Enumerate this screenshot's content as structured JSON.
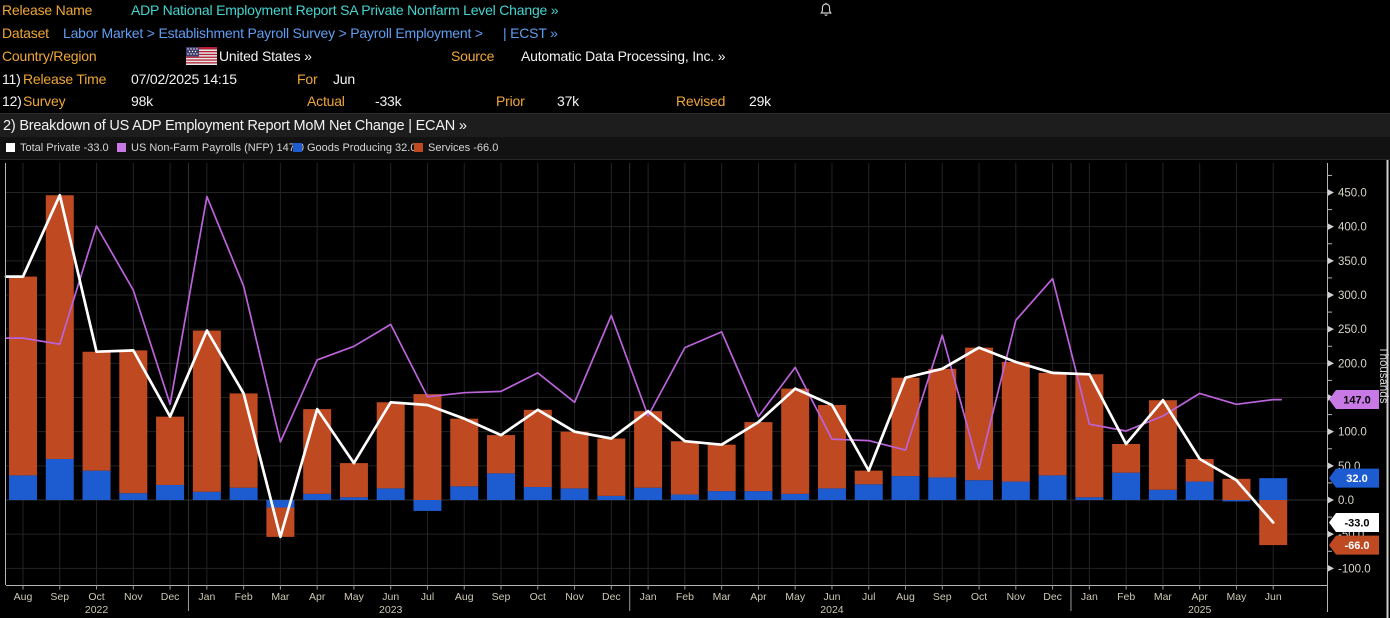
{
  "header": {
    "release_name_label": "Release Name",
    "release_name_value": "ADP National Employment Report SA Private Nonfarm Level Change »",
    "dataset_label": "Dataset",
    "dataset_value": "Labor Market > Establishment Payroll Survey > Payroll Employment >",
    "dataset_suffix": "| ECST »",
    "country_label": "Country/Region",
    "country_value": "United States »",
    "source_label": "Source",
    "source_value": "Automatic Data Processing, Inc. »",
    "row11_num": "11)",
    "release_time_label": "Release Time",
    "release_time_value": "07/02/2025 14:15",
    "for_label": "For",
    "for_value": "Jun",
    "row12_num": "12)",
    "survey_label": "Survey",
    "survey_value": "98k",
    "actual_label": "Actual",
    "actual_value": "-33k",
    "prior_label": "Prior",
    "prior_value": "37k",
    "revised_label": "Revised",
    "revised_value": "29k",
    "bell_icon": "alert-bell"
  },
  "section_title": "2) Breakdown of US ADP Employment Report MoM Net Change | ECAN »",
  "legend": [
    {
      "label": "Total Private -33.0",
      "color": "#ffffff"
    },
    {
      "label": "US Non-Farm Payrolls (NFP) 147.0",
      "color": "#c979e6"
    },
    {
      "label": "Goods Producing 32.0",
      "color": "#1d5bd1"
    },
    {
      "label": "Services -66.0",
      "color": "#bf4a22"
    }
  ],
  "chart_data": {
    "type": "bar",
    "subtype": "stacked bars with overlaid lines",
    "unit_label": "Thousands",
    "ylim": [
      -124,
      494
    ],
    "yticks_major": [
      -100,
      -50,
      0,
      50,
      100,
      150,
      200,
      250,
      300,
      350,
      400,
      450
    ],
    "ytick_minor_step": 25,
    "grid": true,
    "categories": [
      "Aug",
      "Sep",
      "Oct",
      "Nov",
      "Dec",
      "Jan",
      "Feb",
      "Mar",
      "Apr",
      "May",
      "Jun",
      "Jul",
      "Aug",
      "Sep",
      "Oct",
      "Nov",
      "Dec",
      "Jan",
      "Feb",
      "Mar",
      "Apr",
      "May",
      "Jun",
      "Jul",
      "Aug",
      "Sep",
      "Oct",
      "Nov",
      "Dec",
      "Jan",
      "Feb",
      "Mar",
      "Apr",
      "May",
      "Jun"
    ],
    "year_labels": [
      {
        "label": "2022",
        "month_index": 2
      },
      {
        "label": "2023",
        "month_index": 10
      },
      {
        "label": "2024",
        "month_index": 22
      },
      {
        "label": "2025",
        "month_index": 32
      }
    ],
    "year_boundaries_after_index": [
      4,
      16,
      28
    ],
    "series": [
      {
        "name": "Goods Producing",
        "type": "bar",
        "color": "#1d5bd1",
        "values": [
          36,
          60,
          43,
          10,
          22,
          12,
          18,
          -11,
          9,
          4,
          17,
          -16,
          20,
          39,
          19,
          17,
          6,
          18,
          8,
          13,
          13,
          9,
          17,
          23,
          35,
          33,
          29,
          27,
          36,
          4,
          40,
          15,
          27,
          -2,
          32
        ]
      },
      {
        "name": "Services",
        "type": "bar",
        "color": "#bf4a22",
        "values": [
          291,
          386,
          174,
          209,
          100,
          236,
          138,
          -43,
          124,
          50,
          126,
          155,
          99,
          56,
          113,
          83,
          84,
          112,
          78,
          68,
          101,
          154,
          122,
          20,
          144,
          159,
          194,
          175,
          150,
          180,
          42,
          131,
          33,
          31,
          -66
        ]
      },
      {
        "name": "Total Private",
        "type": "line",
        "color": "#ffffff",
        "values": [
          327,
          446,
          217,
          219,
          122,
          248,
          156,
          -54,
          133,
          54,
          143,
          139,
          119,
          95,
          132,
          100,
          90,
          130,
          86,
          81,
          114,
          163,
          139,
          43,
          179,
          192,
          223,
          202,
          186,
          184,
          82,
          146,
          60,
          29,
          -33
        ]
      },
      {
        "name": "US Non-Farm Payrolls (NFP)",
        "type": "line",
        "color": "#bb63da",
        "values": [
          237,
          228,
          401,
          307,
          140,
          444,
          313,
          85,
          205,
          225,
          257,
          151,
          157,
          159,
          186,
          143,
          270,
          123,
          223,
          246,
          122,
          194,
          89,
          87,
          73,
          241,
          46,
          263,
          324,
          111,
          101,
          123,
          156,
          140,
          147
        ]
      }
    ],
    "end_value_badges": [
      {
        "text": "147.0",
        "value": 147,
        "fill": "#c979e6",
        "text_color": "#000000"
      },
      {
        "text": "32.0",
        "value": 32,
        "fill": "#1d5bd1",
        "text_color": "#ffffff"
      },
      {
        "text": "-33.0",
        "value": -33,
        "fill": "#ffffff",
        "text_color": "#000000"
      },
      {
        "text": "-66.0",
        "value": -66,
        "fill": "#bf4a22",
        "text_color": "#ffffff"
      }
    ]
  }
}
